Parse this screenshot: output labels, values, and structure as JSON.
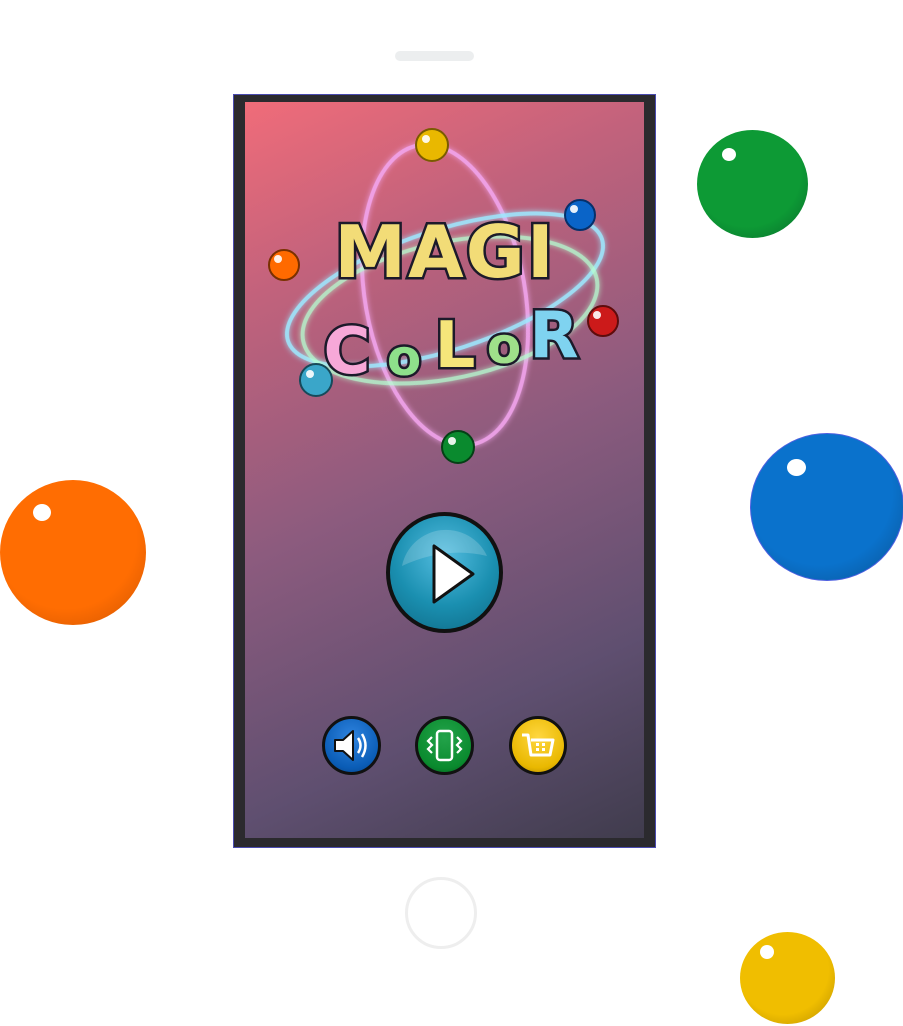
{
  "game": {
    "logo_line1": "MAGI",
    "logo_line2": [
      "C",
      "o",
      "L",
      "o",
      "R"
    ],
    "logo_line2_colors": [
      "#f7a8d8",
      "#8ee08b",
      "#f5e57a",
      "#9fe08a",
      "#7fd3f0"
    ]
  },
  "menu": {
    "play_icon": "play-icon",
    "sound_icon": "speaker-icon",
    "vibration_icon": "vibration-icon",
    "shop_icon": "shopping-cart-icon"
  },
  "colors": {
    "orange": "#ff6a00",
    "green": "#0a8a2e",
    "blue": "#0a6ec8",
    "yellow": "#e9b800",
    "red": "#cc1a1a",
    "cyan": "#3aa6c9",
    "play_button": "#1a8fb0"
  }
}
